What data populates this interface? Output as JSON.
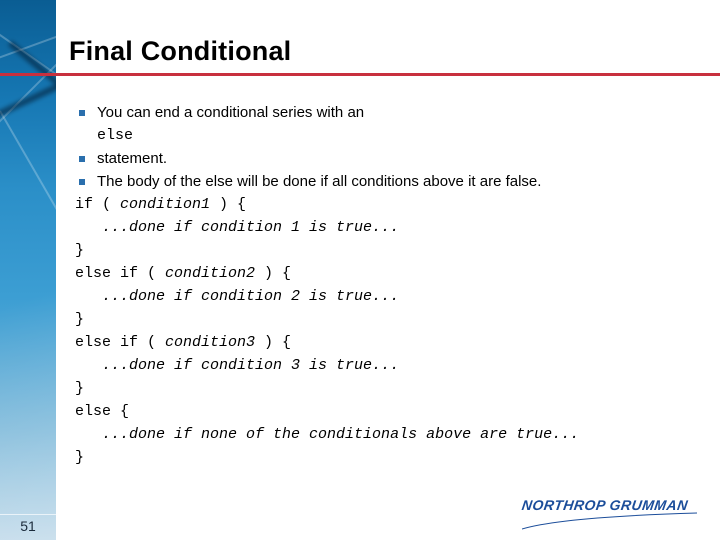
{
  "slide": {
    "title": "Final Conditional",
    "page_number": "51",
    "accent_color": "#c8303e",
    "bullet_color": "#2a6fad"
  },
  "bullets": [
    {
      "text": "You can end a conditional series with an"
    },
    {
      "text": "statement."
    },
    {
      "text": "The body of the else will be done if all conditions above it are false."
    }
  ],
  "inline_code": "else",
  "code": {
    "lines": [
      {
        "plain": "if ( ",
        "italic": "condition1",
        "tail": " ) {"
      },
      {
        "plain": "   ",
        "italic": "...done if condition 1 is true...",
        "tail": ""
      },
      {
        "plain": "}",
        "italic": "",
        "tail": ""
      },
      {
        "plain": "else if ( ",
        "italic": "condition2",
        "tail": " ) {"
      },
      {
        "plain": "   ",
        "italic": "...done if condition 2 is true...",
        "tail": ""
      },
      {
        "plain": "}",
        "italic": "",
        "tail": ""
      },
      {
        "plain": "else if ( ",
        "italic": "condition3",
        "tail": " ) {"
      },
      {
        "plain": "   ",
        "italic": "...done if condition 3 is true...",
        "tail": ""
      },
      {
        "plain": "}",
        "italic": "",
        "tail": ""
      },
      {
        "plain": "else {",
        "italic": "",
        "tail": ""
      },
      {
        "plain": "   ",
        "italic": "...done if none of the conditionals above are true...",
        "tail": ""
      },
      {
        "plain": "}",
        "italic": "",
        "tail": ""
      }
    ]
  },
  "logo": {
    "text": "NORTHROP GRUMMAN",
    "color": "#1b4d9a"
  }
}
